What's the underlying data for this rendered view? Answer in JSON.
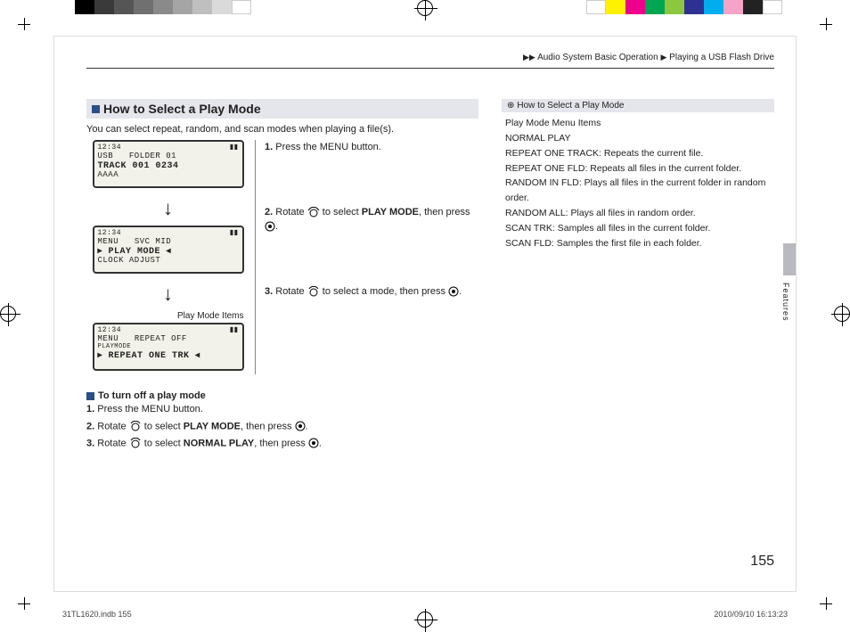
{
  "header": {
    "breadcrumb_1": "Audio System Basic Operation",
    "breadcrumb_2": "Playing a USB Flash Drive"
  },
  "main": {
    "section_title": "How to Select a Play Mode",
    "intro": "You can select repeat, random, and scan modes when playing a file(s).",
    "lcd1": {
      "clock": "12:34",
      "label": "USB",
      "l1": "FOLDER 01",
      "l2": "TRACK 001   0234",
      "l3": "AAAA"
    },
    "lcd2": {
      "clock": "12:34",
      "label": "MENU",
      "l1": "SVC        MID",
      "l2": "PLAY  MODE",
      "l3": "CLOCK ADJUST"
    },
    "play_mode_items_label": "Play Mode Items",
    "lcd3": {
      "clock": "12:34",
      "label": "MENU",
      "sub": "PLAYMODE",
      "l1": "REPEAT OFF",
      "l2": "REPEAT ONE TRK"
    },
    "step1": "Press the MENU button.",
    "step2_a": "Rotate ",
    "step2_b": " to select ",
    "step2_bold": "PLAY MODE",
    "step2_c": ", then press ",
    "step2_d": ".",
    "step3_a": "Rotate ",
    "step3_b": " to select a mode, then press ",
    "step3_c": ".",
    "sub_title": "To turn off a play mode",
    "off1": "Press the MENU button.",
    "off2_a": "Rotate ",
    "off2_b": " to select ",
    "off2_bold": "PLAY MODE",
    "off2_c": ", then press ",
    "off2_d": ".",
    "off3_a": "Rotate ",
    "off3_b": " to select ",
    "off3_bold": "NORMAL PLAY",
    "off3_c": ", then press ",
    "off3_d": "."
  },
  "sidebar": {
    "title": "How to Select a Play Mode",
    "lines": [
      "Play Mode Menu Items",
      "NORMAL PLAY",
      "REPEAT ONE TRACK: Repeats the current file.",
      "REPEAT ONE FLD: Repeats all files in the current folder.",
      "RANDOM IN FLD: Plays all files in the current folder in random order.",
      "RANDOM ALL: Plays all files in random order.",
      "SCAN TRK: Samples all files in the current folder.",
      "SCAN FLD: Samples the first file in each folder."
    ],
    "tab_label": "Features"
  },
  "page_number": "155",
  "footer": {
    "left": "31TL1620.indb   155",
    "right": "2010/09/10   16:13:23"
  },
  "colors": {
    "left_bar": [
      "#000000",
      "#3a3a3a",
      "#555555",
      "#707070",
      "#8a8a8a",
      "#a5a5a5",
      "#bfbfbf",
      "#dadada",
      "#ffffff"
    ],
    "right_bar": [
      "#ffffff",
      "#fff200",
      "#ec008c",
      "#00a651",
      "#8dc63f",
      "#2e3192",
      "#00aeef",
      "#f5a3c7",
      "#222222",
      "#ffffff"
    ]
  }
}
